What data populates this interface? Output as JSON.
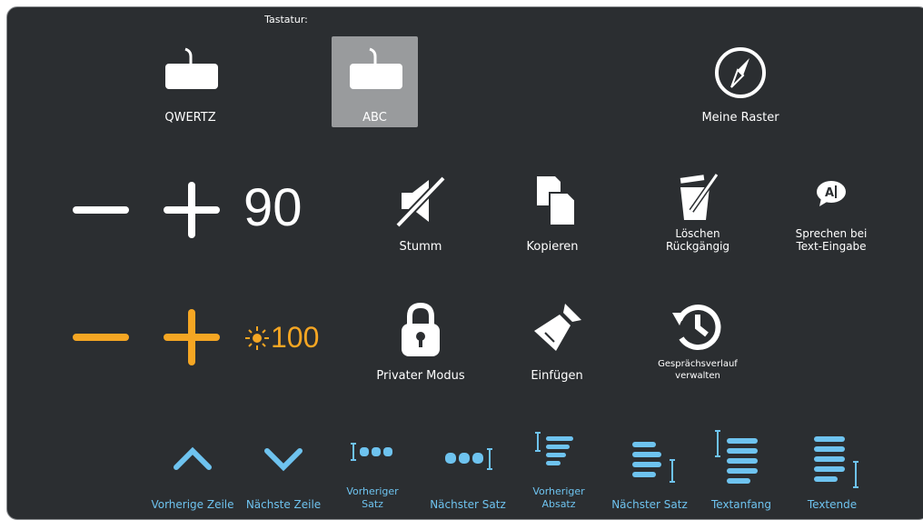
{
  "header": {
    "keyboard_label": "Tastatur:"
  },
  "keyboards": [
    {
      "label": "QWERTZ",
      "selected": false
    },
    {
      "label": "ABC",
      "selected": true
    }
  ],
  "my_grids": {
    "label": "Meine Raster"
  },
  "volume": {
    "value": "90"
  },
  "brightness": {
    "value": "100"
  },
  "actions": {
    "mute": "Stumm",
    "copy": "Kopieren",
    "delete_undo_line1": "Löschen",
    "delete_undo_line2": "Rückgängig",
    "speak_line1": "Sprechen bei",
    "speak_line2": "Text-Eingabe",
    "private_mode": "Privater Modus",
    "paste": "Einfügen",
    "history_line1": "Gesprächsverlauf",
    "history_line2": "verwalten"
  },
  "navigation": {
    "prev_line": "Vorherige Zeile",
    "next_line": "Nächste Zeile",
    "prev_sentence_line1": "Vorheriger",
    "prev_sentence_line2": "Satz",
    "next_sentence": "Nächster Satz",
    "prev_paragraph_line1": "Vorheriger",
    "prev_paragraph_line2": "Absatz",
    "next_paragraph": "Nächster Satz",
    "text_start": "Textanfang",
    "text_end": "Textende"
  },
  "colors": {
    "accent_blue": "#6ec3ef",
    "accent_orange": "#f5a623",
    "background": "#2b2e31",
    "selected": "#999b9d"
  }
}
